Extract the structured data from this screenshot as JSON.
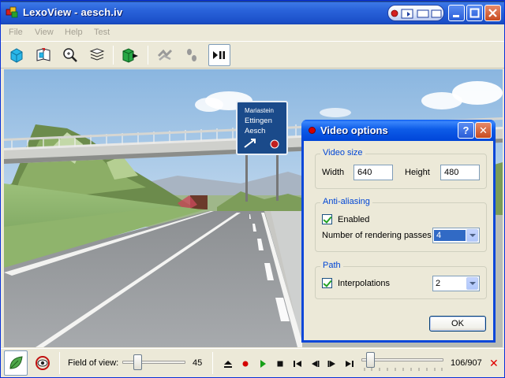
{
  "window": {
    "title": "LexoView - aesch.iv"
  },
  "menu": {
    "items": [
      "File",
      "View",
      "Help",
      "Test"
    ]
  },
  "toolbar": {
    "tools": [
      "cube-icon",
      "book-icon",
      "zoom-icon",
      "layers-icon",
      "green-cube-arrow-icon",
      "trees-icon",
      "footprints-icon",
      "play-pause-icon"
    ]
  },
  "scene": {
    "sign": {
      "line1": "Mariastein",
      "line2": "Ettingen",
      "line3": "Aesch"
    }
  },
  "dialog": {
    "title": "Video options",
    "help_label": "?",
    "close_label": "✕",
    "video_size": {
      "label": "Video size",
      "width_label": "Width",
      "width_value": "640",
      "height_label": "Height",
      "height_value": "480"
    },
    "anti_aliasing": {
      "label": "Anti-aliasing",
      "enabled_label": "Enabled",
      "enabled": true,
      "passes_label": "Number of rendering passes",
      "passes_value": "4"
    },
    "path": {
      "label": "Path",
      "interpolations_label": "Interpolations",
      "interpolations": true,
      "interpolations_value": "2"
    },
    "ok_label": "OK"
  },
  "statusbar": {
    "fov_label": "Field of view:",
    "fov_value": "45",
    "fov_fraction": 0.25,
    "frame_counter": "106/907",
    "frame_fraction": 0.117,
    "stop_label": "✕"
  }
}
